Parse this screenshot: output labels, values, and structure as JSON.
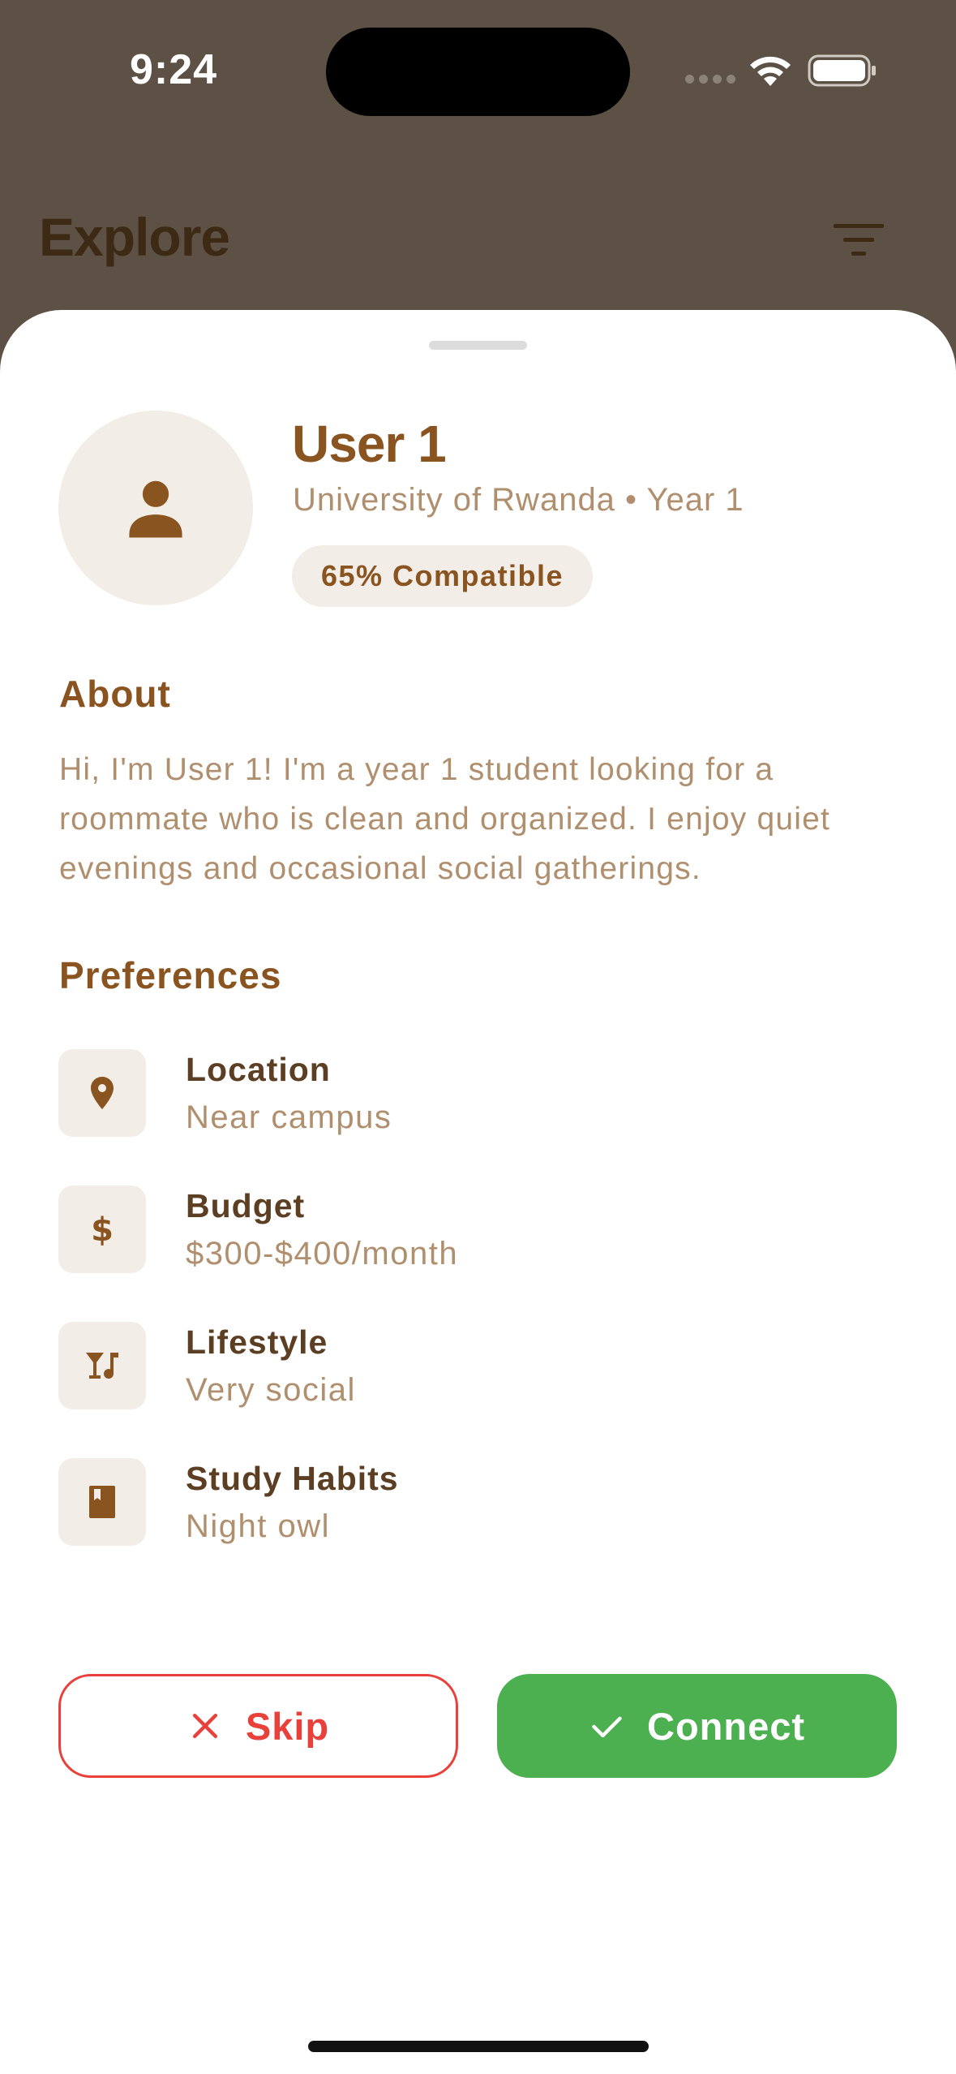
{
  "status_bar": {
    "time": "9:24"
  },
  "header": {
    "title": "Explore",
    "filter_icon": "filter-icon"
  },
  "profile": {
    "name": "User 1",
    "subtitle": "University of Rwanda • Year 1",
    "compatibility": "65% Compatible",
    "avatar_icon": "person-icon"
  },
  "about": {
    "title": "About",
    "text": "Hi, I'm User 1! I'm a year 1 student looking for a roommate who is clean and organized. I enjoy quiet evenings and occasional social gatherings."
  },
  "preferences": {
    "title": "Preferences",
    "items": [
      {
        "label": "Location",
        "value": "Near campus",
        "icon": "location-pin-icon"
      },
      {
        "label": "Budget",
        "value": "$300-$400/month",
        "icon": "dollar-icon"
      },
      {
        "label": "Lifestyle",
        "value": "Very social",
        "icon": "nightlife-icon"
      },
      {
        "label": "Study Habits",
        "value": "Night owl",
        "icon": "book-icon"
      }
    ]
  },
  "actions": {
    "skip_label": "Skip",
    "connect_label": "Connect"
  },
  "colors": {
    "brand_brown": "#8a5421",
    "muted_text": "#b08f6e",
    "chip_bg": "#f3ede7",
    "skip_red": "#e8403a",
    "connect_green": "#4caf50"
  }
}
